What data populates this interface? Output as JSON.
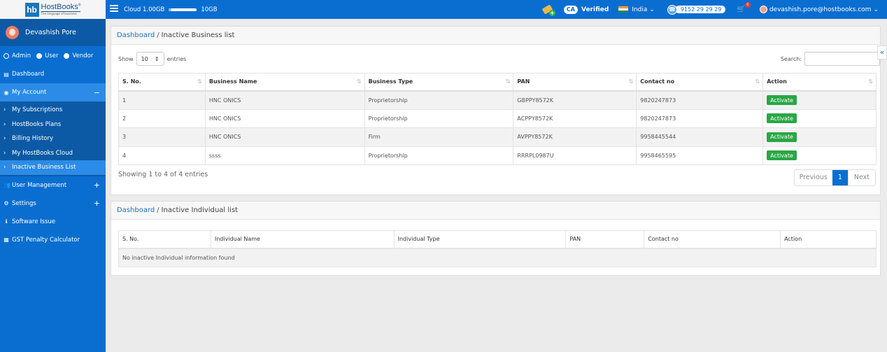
{
  "brand": {
    "logo_mark": "hb",
    "name": "HostBooks",
    "registered": "®",
    "tagline": "The language of business"
  },
  "topbar": {
    "cloud_label": "Cloud 1.00GB",
    "cloud_total": "10GB",
    "cloud_usage_fraction": 0.1,
    "ca_label": "CA",
    "verified": "Verified",
    "country": "India",
    "phone": "9152 29 29 29",
    "cart_count": "0",
    "user_email": "devashish.pore@hostbooks.com"
  },
  "sidebar": {
    "user_name": "Devashish Pore",
    "roles": [
      {
        "label": "Admin",
        "selected": true
      },
      {
        "label": "User",
        "selected": false
      },
      {
        "label": "Vendor",
        "selected": false
      }
    ],
    "dashboard": "Dashboard",
    "my_account": "My Account",
    "my_account_toggle": "−",
    "sub_items": [
      "My Subscriptions",
      "HostBooks Plans",
      "Billing History",
      "My HostBooks Cloud",
      "Inactive Business List"
    ],
    "user_management": "User Management",
    "settings": "Settings",
    "software_issue": "Software Issue",
    "gst_calc": "GST Penalty Calculator",
    "plus": "+"
  },
  "business_panel": {
    "breadcrumb_link": "Dashboard",
    "breadcrumb_sep": "/",
    "breadcrumb_current": "Inactive Business list",
    "show_label": "Show",
    "entries_value": "10",
    "entries_label": "entries",
    "search_label": "Search:",
    "search_value": "",
    "columns": [
      "S. No.",
      "Business Name",
      "Business Type",
      "PAN",
      "Contact no",
      "Action"
    ],
    "rows": [
      {
        "sno": "1",
        "name": "HNC ONICS",
        "type": "Proprietorship",
        "pan": "GBPPY8572K",
        "contact": "9820247873",
        "action": "Activate"
      },
      {
        "sno": "2",
        "name": "HNC ONICS",
        "type": "Proprietorship",
        "pan": "ACPPY8572K",
        "contact": "9820247873",
        "action": "Activate"
      },
      {
        "sno": "3",
        "name": "HNC ONICS",
        "type": "Firm",
        "pan": "AVPPY8572K",
        "contact": "9958445544",
        "action": "Activate"
      },
      {
        "sno": "4",
        "name": "ssss",
        "type": "Proprietorship",
        "pan": "RRRPL0987U",
        "contact": "9958465595",
        "action": "Activate"
      }
    ],
    "info": "Showing 1 to 4 of 4 entries",
    "pager": {
      "previous": "Previous",
      "current": "1",
      "next": "Next"
    }
  },
  "individual_panel": {
    "breadcrumb_link": "Dashboard",
    "breadcrumb_sep": "/",
    "breadcrumb_current": "Inactive Individual list",
    "columns": [
      "S. No.",
      "Individual Name",
      "Individual Type",
      "PAN",
      "Contact no",
      "Action"
    ],
    "empty_message": "No inactive Individual information found"
  },
  "colors": {
    "primary": "#0a6ed1",
    "sidebar_dark": "#0c5aa6",
    "active": "#2b8be6",
    "success": "#28a745"
  }
}
